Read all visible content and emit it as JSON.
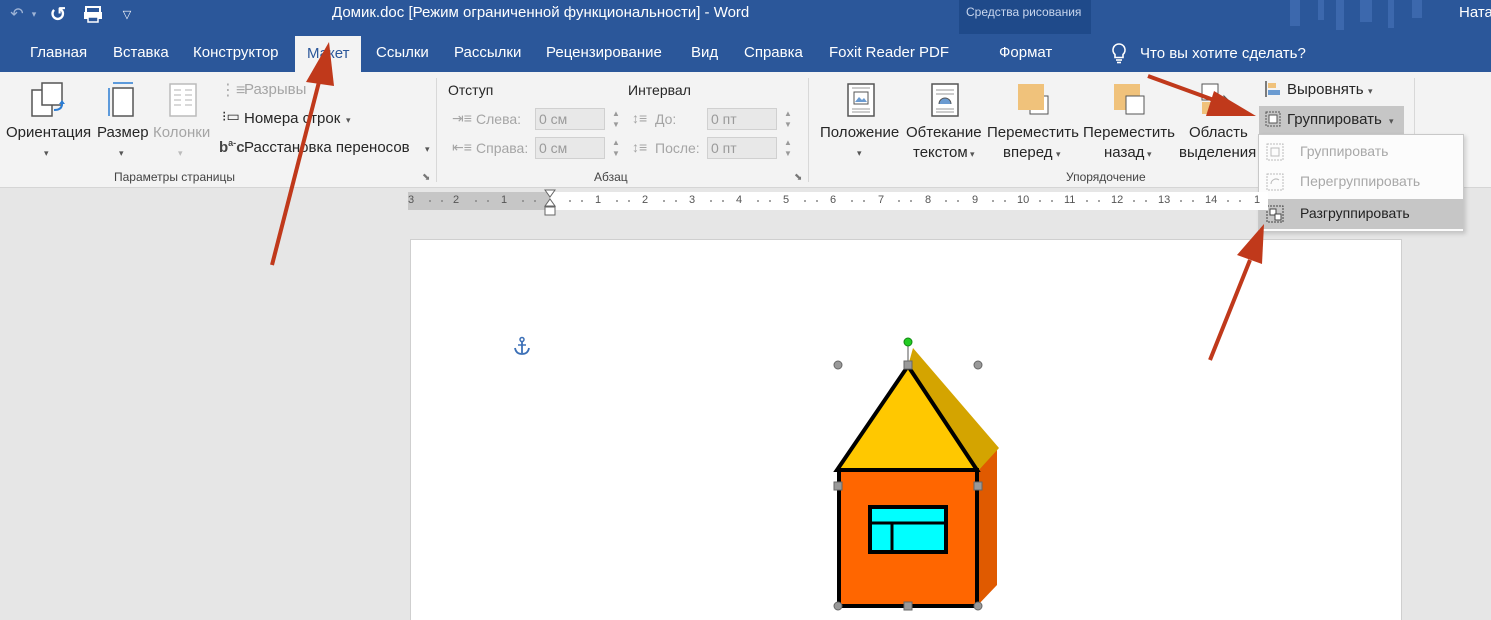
{
  "window": {
    "title": "Домик.doc [Режим ограниченной функциональности]  -  Word",
    "context_header": "Средства рисования",
    "user": "Ната"
  },
  "tabs": [
    {
      "label": "Главная"
    },
    {
      "label": "Вставка"
    },
    {
      "label": "Конструктор"
    },
    {
      "label": "Макет"
    },
    {
      "label": "Ссылки"
    },
    {
      "label": "Рассылки"
    },
    {
      "label": "Рецензирование"
    },
    {
      "label": "Вид"
    },
    {
      "label": "Справка"
    },
    {
      "label": "Foxit Reader PDF"
    },
    {
      "label": "Формат"
    }
  ],
  "tell_me": "Что вы хотите сделать?",
  "page_setup": {
    "orientation": "Ориентация",
    "size": "Размер",
    "columns": "Колонки",
    "breaks": "Разрывы",
    "line_numbers": "Номера строк",
    "hyphenation": "Расстановка переносов",
    "group_label": "Параметры страницы"
  },
  "paragraph": {
    "indent_label": "Отступ",
    "spacing_label": "Интервал",
    "left_label": "Слева:",
    "right_label": "Справа:",
    "left_value": "0 см",
    "right_value": "0 см",
    "before_label": "До:",
    "after_label": "После:",
    "before_value": "0 пт",
    "after_value": "0 пт",
    "group_label": "Абзац"
  },
  "arrange": {
    "position_1": "Положение",
    "wrap_1": "Обтекание",
    "wrap_2": "текстом",
    "forward_1": "Переместить",
    "forward_2": "вперед",
    "backward_1": "Переместить",
    "backward_2": "назад",
    "selection_1": "Область",
    "selection_2": "выделения",
    "align": "Выровнять",
    "group": "Группировать",
    "group_label": "Упорядочение"
  },
  "group_menu": [
    {
      "label": "Группировать",
      "enabled": false
    },
    {
      "label": "Перегруппировать",
      "enabled": false
    },
    {
      "label": "Разгруппировать",
      "enabled": true
    }
  ],
  "ruler": {
    "labels": [
      "3",
      "2",
      "1",
      "1",
      "2",
      "3",
      "4",
      "5",
      "6",
      "7",
      "8",
      "9",
      "10",
      "11",
      "12",
      "13",
      "14",
      "1"
    ]
  },
  "colors": {
    "titlebar": "#2b579a",
    "annotation_arrow": "#c0391b",
    "house_wall": "#ff6600",
    "house_roof": "#ffc000",
    "house_window": "#00ffff"
  }
}
